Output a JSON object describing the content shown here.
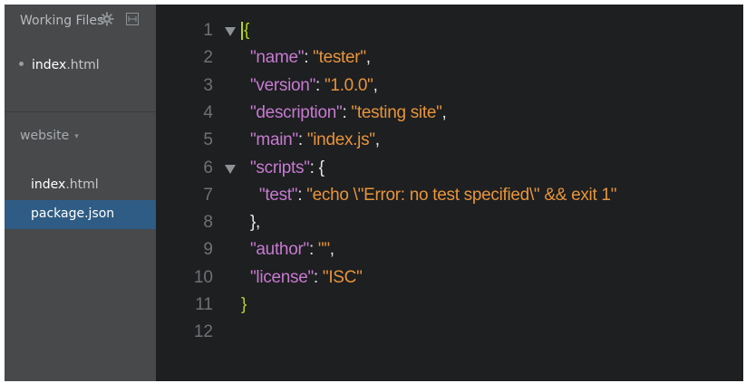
{
  "sidebar": {
    "working_files_title": "Working Files",
    "working_files": [
      {
        "name": "index",
        "ext": ".html"
      }
    ],
    "project_name": "website",
    "project_caret": "▾",
    "tree": [
      {
        "name": "index",
        "ext": ".html",
        "selected": false
      },
      {
        "name": "package.json",
        "ext": "",
        "selected": true
      }
    ]
  },
  "editor": {
    "line_numbers": [
      "1",
      "2",
      "3",
      "4",
      "5",
      "6",
      "7",
      "8",
      "9",
      "10",
      "11",
      "12"
    ],
    "lines": [
      {
        "indent": "",
        "tokens": [
          {
            "t": "bracket",
            "v": "{"
          }
        ]
      },
      {
        "indent": "  ",
        "tokens": [
          {
            "t": "key",
            "v": "\"name\""
          },
          {
            "t": "punc",
            "v": ": "
          },
          {
            "t": "str",
            "v": "\"tester\""
          },
          {
            "t": "punc",
            "v": ","
          }
        ]
      },
      {
        "indent": "  ",
        "tokens": [
          {
            "t": "key",
            "v": "\"version\""
          },
          {
            "t": "punc",
            "v": ": "
          },
          {
            "t": "str",
            "v": "\"1.0.0\""
          },
          {
            "t": "punc",
            "v": ","
          }
        ]
      },
      {
        "indent": "  ",
        "tokens": [
          {
            "t": "key",
            "v": "\"description\""
          },
          {
            "t": "punc",
            "v": ": "
          },
          {
            "t": "str",
            "v": "\"testing site\""
          },
          {
            "t": "punc",
            "v": ","
          }
        ]
      },
      {
        "indent": "  ",
        "tokens": [
          {
            "t": "key",
            "v": "\"main\""
          },
          {
            "t": "punc",
            "v": ": "
          },
          {
            "t": "str",
            "v": "\"index.js\""
          },
          {
            "t": "punc",
            "v": ","
          }
        ]
      },
      {
        "indent": "  ",
        "tokens": [
          {
            "t": "key",
            "v": "\"scripts\""
          },
          {
            "t": "punc",
            "v": ": {"
          }
        ]
      },
      {
        "indent": "    ",
        "tokens": [
          {
            "t": "key",
            "v": "\"test\""
          },
          {
            "t": "punc",
            "v": ": "
          },
          {
            "t": "str",
            "v": "\"echo \\\"Error: no test specified\\\" && exit 1\""
          }
        ]
      },
      {
        "indent": "  ",
        "tokens": [
          {
            "t": "punc",
            "v": "},"
          }
        ]
      },
      {
        "indent": "  ",
        "tokens": [
          {
            "t": "key",
            "v": "\"author\""
          },
          {
            "t": "punc",
            "v": ": "
          },
          {
            "t": "str",
            "v": "\"\""
          },
          {
            "t": "punc",
            "v": ","
          }
        ]
      },
      {
        "indent": "  ",
        "tokens": [
          {
            "t": "key",
            "v": "\"license\""
          },
          {
            "t": "punc",
            "v": ": "
          },
          {
            "t": "str",
            "v": "\"ISC\""
          }
        ]
      },
      {
        "indent": "",
        "tokens": [
          {
            "t": "bracket",
            "v": "}"
          }
        ]
      },
      {
        "indent": "",
        "tokens": []
      }
    ],
    "fold_lines": [
      1,
      6
    ]
  },
  "colors": {
    "sidebar_bg": "#47494b",
    "selected_bg": "#2e5c84",
    "editor_bg": "#1d1f21",
    "key": "#c77ad0",
    "string": "#e8943a",
    "bracket": "#b4d41e",
    "line_number": "#6e7275"
  }
}
